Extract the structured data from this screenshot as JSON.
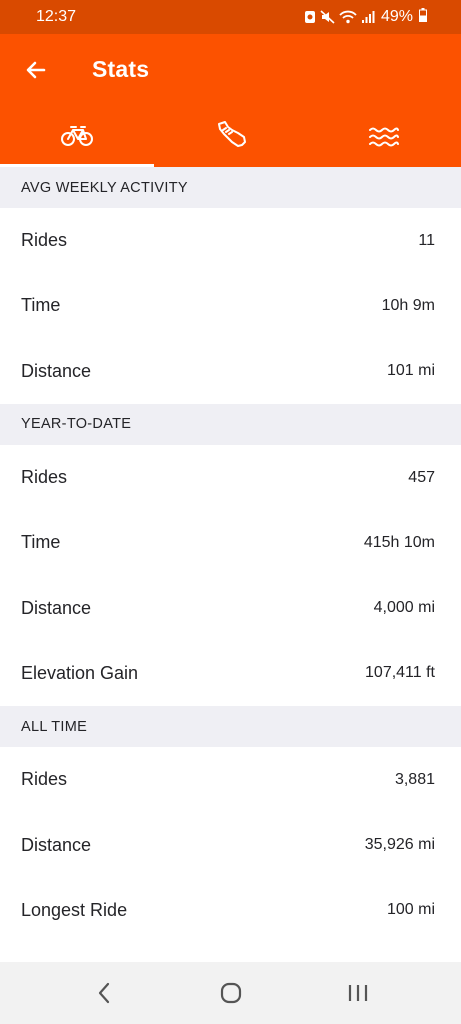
{
  "status_bar": {
    "time": "12:37",
    "battery": "49%",
    "icons": [
      "notification-icon",
      "mute-icon",
      "wifi-icon",
      "signal-icon",
      "battery-icon"
    ]
  },
  "header": {
    "title": "Stats",
    "back_icon": "arrow-left-icon",
    "background_color": "#fc5200"
  },
  "tabs": [
    {
      "icon": "bike-icon",
      "active": true
    },
    {
      "icon": "shoe-icon",
      "active": false
    },
    {
      "icon": "swim-icon",
      "active": false
    }
  ],
  "sections": {
    "weekly": {
      "title": "AVG WEEKLY ACTIVITY",
      "rows": [
        {
          "label": "Rides",
          "value": "11"
        },
        {
          "label": "Time",
          "value": "10h 9m"
        },
        {
          "label": "Distance",
          "value": "101 mi"
        }
      ]
    },
    "ytd": {
      "title": "YEAR-TO-DATE",
      "rows": [
        {
          "label": "Rides",
          "value": "457"
        },
        {
          "label": "Time",
          "value": "415h 10m"
        },
        {
          "label": "Distance",
          "value": "4,000 mi"
        },
        {
          "label": "Elevation Gain",
          "value": "107,411 ft"
        }
      ]
    },
    "all_time": {
      "title": "ALL TIME",
      "rows": [
        {
          "label": "Rides",
          "value": "3,881"
        },
        {
          "label": "Distance",
          "value": "35,926 mi"
        },
        {
          "label": "Longest Ride",
          "value": "100 mi"
        }
      ]
    }
  },
  "nav_bar": {
    "buttons": [
      "back-nav-icon",
      "home-nav-icon",
      "recents-nav-icon"
    ]
  }
}
